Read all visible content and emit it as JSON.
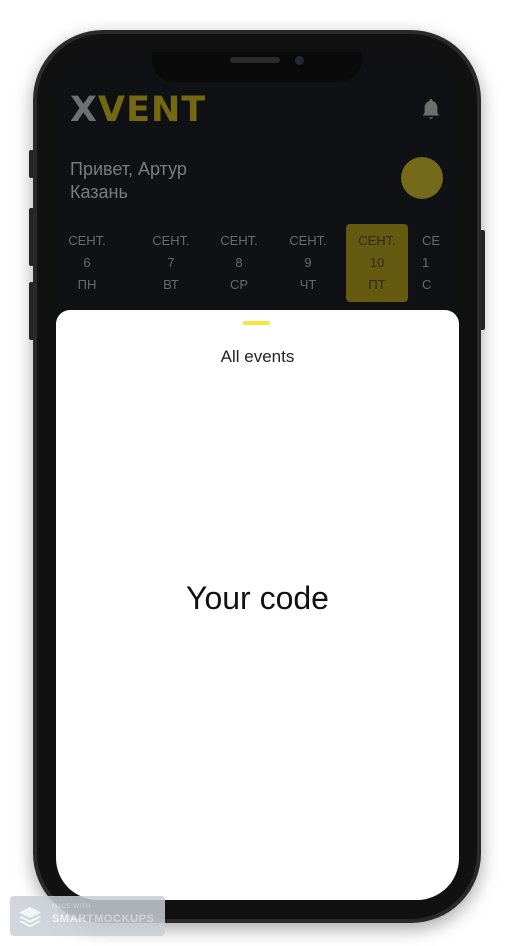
{
  "app": {
    "logo_x": "X",
    "logo_rest": "VENT",
    "greeting": "Привет, Артур",
    "city": "Казань"
  },
  "days": [
    {
      "month": "СЕНТ.",
      "date": "6",
      "weekday": "ПН",
      "active": false
    },
    {
      "month": "СЕНТ.",
      "date": "7",
      "weekday": "ВТ",
      "active": false
    },
    {
      "month": "СЕНТ.",
      "date": "8",
      "weekday": "СР",
      "active": false
    },
    {
      "month": "СЕНТ.",
      "date": "9",
      "weekday": "ЧТ",
      "active": false
    },
    {
      "month": "СЕНТ.",
      "date": "10",
      "weekday": "ПТ",
      "active": true
    },
    {
      "month": "СЕ",
      "date": "1",
      "weekday": "С",
      "active": false
    }
  ],
  "sheet": {
    "title": "All events",
    "body": "Your code"
  },
  "watermark": {
    "small": "MADE WITH",
    "text": "SMARTMOCKUPS"
  },
  "icons": {
    "notifications": "bell-icon",
    "watermark": "layers-icon"
  },
  "colors": {
    "accent": "#f4e63a",
    "accent_dimmed": "#75691a",
    "header_bg": "#0f1114",
    "sheet_bg": "#ffffff"
  }
}
